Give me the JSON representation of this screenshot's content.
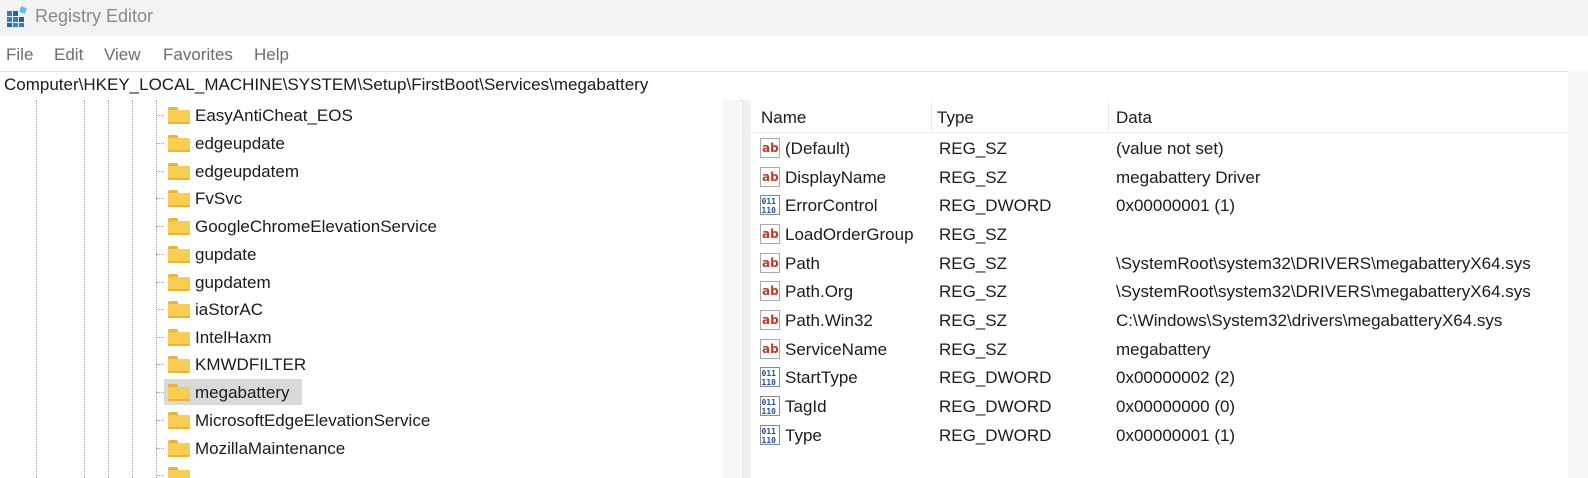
{
  "window": {
    "title": "Registry Editor",
    "app_icon": "registry-icon"
  },
  "menu": [
    "File",
    "Edit",
    "View",
    "Favorites",
    "Help"
  ],
  "address": "Computer\\HKEY_LOCAL_MACHINE\\SYSTEM\\Setup\\FirstBoot\\Services\\megabattery",
  "tree": {
    "items": [
      "EasyAntiCheat_EOS",
      "edgeupdate",
      "edgeupdatem",
      "FvSvc",
      "GoogleChromeElevationService",
      "gupdate",
      "gupdatem",
      "iaStorAC",
      "IntelHaxm",
      "KMWDFILTER",
      "megabattery",
      "MicrosoftEdgeElevationService",
      "MozillaMaintenance"
    ],
    "selected": "megabattery",
    "item_icon": "folder-icon"
  },
  "values": {
    "columns": [
      "Name",
      "Type",
      "Data"
    ],
    "rows": [
      {
        "icon": "string-value-icon",
        "name": "(Default)",
        "type": "REG_SZ",
        "data": "(value not set)"
      },
      {
        "icon": "string-value-icon",
        "name": "DisplayName",
        "type": "REG_SZ",
        "data": "megabattery Driver"
      },
      {
        "icon": "dword-value-icon",
        "name": "ErrorControl",
        "type": "REG_DWORD",
        "data": "0x00000001 (1)"
      },
      {
        "icon": "string-value-icon",
        "name": "LoadOrderGroup",
        "type": "REG_SZ",
        "data": ""
      },
      {
        "icon": "string-value-icon",
        "name": "Path",
        "type": "REG_SZ",
        "data": "\\SystemRoot\\system32\\DRIVERS\\megabatteryX64.sys"
      },
      {
        "icon": "string-value-icon",
        "name": "Path.Org",
        "type": "REG_SZ",
        "data": "\\SystemRoot\\system32\\DRIVERS\\megabatteryX64.sys"
      },
      {
        "icon": "string-value-icon",
        "name": "Path.Win32",
        "type": "REG_SZ",
        "data": "C:\\Windows\\System32\\drivers\\megabatteryX64.sys"
      },
      {
        "icon": "string-value-icon",
        "name": "ServiceName",
        "type": "REG_SZ",
        "data": "megabattery"
      },
      {
        "icon": "dword-value-icon",
        "name": "StartType",
        "type": "REG_DWORD",
        "data": "0x00000002 (2)"
      },
      {
        "icon": "dword-value-icon",
        "name": "TagId",
        "type": "REG_DWORD",
        "data": "0x00000000 (0)"
      },
      {
        "icon": "dword-value-icon",
        "name": "Type",
        "type": "REG_DWORD",
        "data": "0x00000001 (1)"
      }
    ]
  },
  "colors": {
    "selected_bg": "#d9d9d9",
    "folder": "#f9cd52",
    "string_icon": "#c0392b",
    "dword_icon": "#1f4e9e"
  }
}
